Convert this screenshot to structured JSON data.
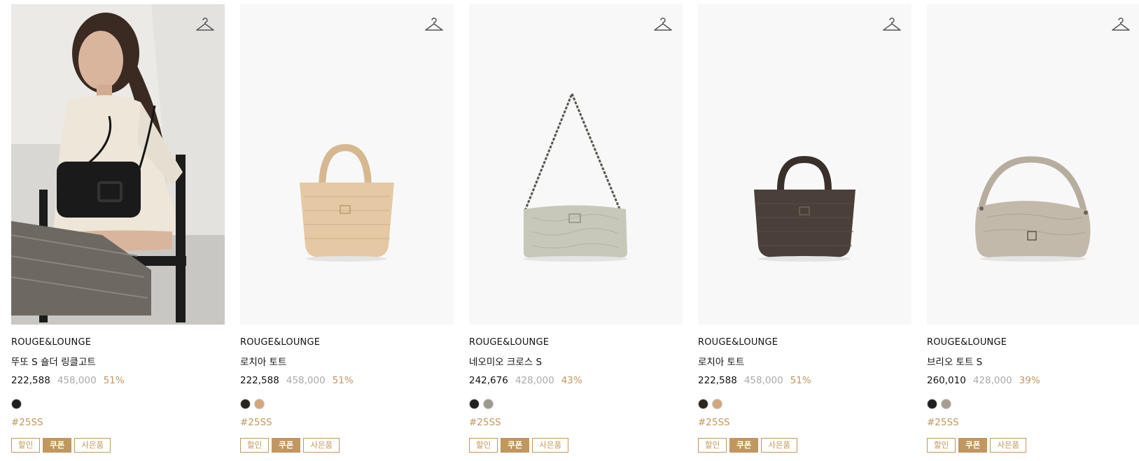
{
  "colors": {
    "accent": "#c1965f",
    "price": "#111111",
    "original_price": "#a9a9a9"
  },
  "products": [
    {
      "brand": "ROUGE&LOUNGE",
      "name": "뚜또 S 숄더 링클고트",
      "price": "222,588",
      "original_price": "458,000",
      "discount": "51%",
      "swatches": [
        "#1f1f1f"
      ],
      "tag": "#25SS",
      "badges": [
        "할인",
        "쿠폰",
        "사은품"
      ],
      "image": "model-with-black-shoulder-bag",
      "icon": "hanger-icon"
    },
    {
      "brand": "ROUGE&LOUNGE",
      "name": "로치아 토트",
      "price": "222,588",
      "original_price": "458,000",
      "discount": "51%",
      "swatches": [
        "#2b2520",
        "#d2a77c"
      ],
      "tag": "#25SS",
      "badges": [
        "할인",
        "쿠폰",
        "사은품"
      ],
      "image": "beige-woven-tote",
      "icon": "hanger-icon"
    },
    {
      "brand": "ROUGE&LOUNGE",
      "name": "네오미오 크로스 S",
      "price": "242,676",
      "original_price": "428,000",
      "discount": "43%",
      "swatches": [
        "#1f1f1f",
        "#9c9a8c"
      ],
      "tag": "#25SS",
      "badges": [
        "할인",
        "쿠폰",
        "사은품"
      ],
      "image": "sage-chain-crossbody",
      "icon": "hanger-icon"
    },
    {
      "brand": "ROUGE&LOUNGE",
      "name": "로치아 토트",
      "price": "222,588",
      "original_price": "458,000",
      "discount": "51%",
      "swatches": [
        "#2b2520",
        "#d2a77c"
      ],
      "tag": "#25SS",
      "badges": [
        "할인",
        "쿠폰",
        "사은품"
      ],
      "image": "brown-woven-tote",
      "icon": "hanger-icon"
    },
    {
      "brand": "ROUGE&LOUNGE",
      "name": "브리오 토트 S",
      "price": "260,010",
      "original_price": "428,000",
      "discount": "39%",
      "swatches": [
        "#1f1f1f",
        "#a79e90"
      ],
      "tag": "#25SS",
      "badges": [
        "할인",
        "쿠폰",
        "사은품"
      ],
      "image": "taupe-leather-hobo",
      "icon": "hanger-icon"
    }
  ]
}
